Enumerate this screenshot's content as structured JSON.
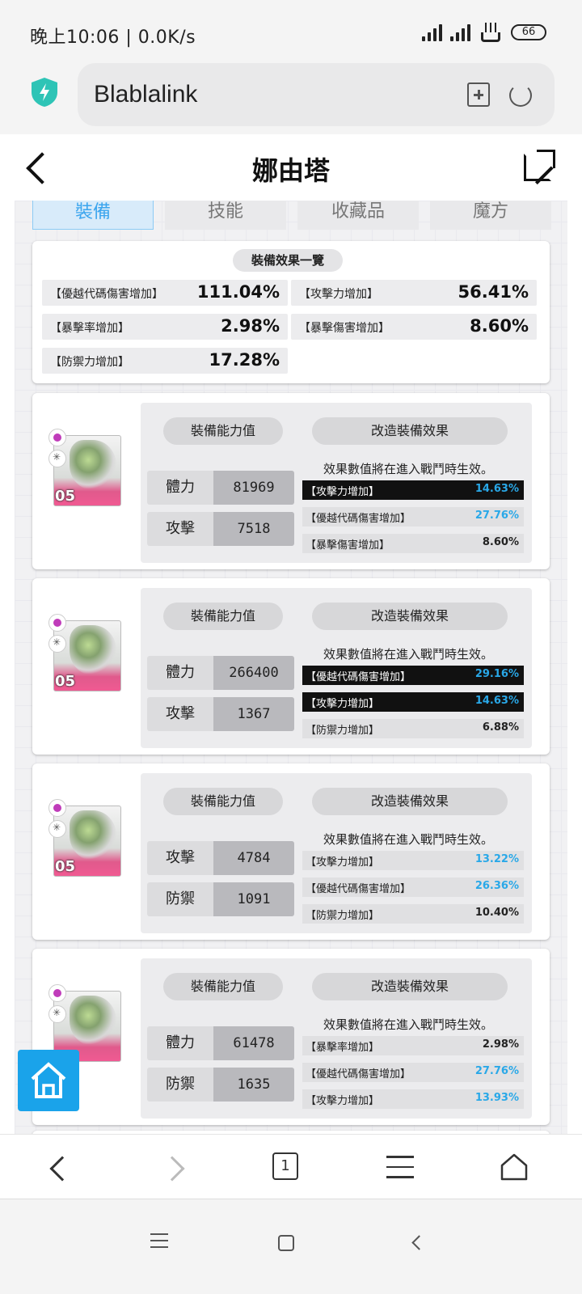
{
  "status_bar": {
    "time": "晚上10:06 | 0.0K/s",
    "battery": "66"
  },
  "browser": {
    "url": "Blablalink"
  },
  "header": {
    "title": "娜由塔"
  },
  "tabs": [
    {
      "label": "裝備",
      "active": true
    },
    {
      "label": "技能",
      "active": false
    },
    {
      "label": "收藏品",
      "active": false
    },
    {
      "label": "魔方",
      "active": false
    }
  ],
  "summary": {
    "title": "裝備效果一覽",
    "items": [
      {
        "label": "【優越代碼傷害增加】",
        "value": "111.04%"
      },
      {
        "label": "【攻擊力增加】",
        "value": "56.41%"
      },
      {
        "label": "【暴擊率增加】",
        "value": "2.98%"
      },
      {
        "label": "【暴擊傷害增加】",
        "value": "8.60%"
      },
      {
        "label": "【防禦力增加】",
        "value": "17.28%"
      }
    ]
  },
  "equipment_common": {
    "stats_title": "裝備能力值",
    "effects_title": "改造裝備效果",
    "note": "效果數值將在進入戰鬥時生效。"
  },
  "equipment": [
    {
      "level": "05",
      "stats": [
        {
          "label": "體力",
          "value": "81969"
        },
        {
          "label": "攻擊",
          "value": "7518"
        }
      ],
      "effects": [
        {
          "label": "【攻擊力增加】",
          "value": "14.63%",
          "highlight": true,
          "value_color": "blue"
        },
        {
          "label": "【優越代碼傷害增加】",
          "value": "27.76%",
          "highlight": false,
          "value_color": "blue"
        },
        {
          "label": "【暴擊傷害增加】",
          "value": "8.60%",
          "highlight": false,
          "value_color": "black"
        }
      ]
    },
    {
      "level": "05",
      "stats": [
        {
          "label": "體力",
          "value": "266400"
        },
        {
          "label": "攻擊",
          "value": "1367"
        }
      ],
      "effects": [
        {
          "label": "【優越代碼傷害增加】",
          "value": "29.16%",
          "highlight": true,
          "value_color": "blue"
        },
        {
          "label": "【攻擊力增加】",
          "value": "14.63%",
          "highlight": true,
          "value_color": "blue"
        },
        {
          "label": "【防禦力增加】",
          "value": "6.88%",
          "highlight": false,
          "value_color": "black"
        }
      ]
    },
    {
      "level": "05",
      "stats": [
        {
          "label": "攻擊",
          "value": "4784"
        },
        {
          "label": "防禦",
          "value": "1091"
        }
      ],
      "effects": [
        {
          "label": "【攻擊力增加】",
          "value": "13.22%",
          "highlight": false,
          "value_color": "blue"
        },
        {
          "label": "【優越代碼傷害增加】",
          "value": "26.36%",
          "highlight": false,
          "value_color": "blue"
        },
        {
          "label": "【防禦力增加】",
          "value": "10.40%",
          "highlight": false,
          "value_color": "black"
        }
      ]
    },
    {
      "level": "",
      "stats": [
        {
          "label": "體力",
          "value": "61478"
        },
        {
          "label": "防禦",
          "value": "1635"
        }
      ],
      "effects": [
        {
          "label": "【暴擊率增加】",
          "value": "2.98%",
          "highlight": false,
          "value_color": "black"
        },
        {
          "label": "【優越代碼傷害增加】",
          "value": "27.76%",
          "highlight": false,
          "value_color": "blue"
        },
        {
          "label": "【攻擊力增加】",
          "value": "13.93%",
          "highlight": false,
          "value_color": "blue"
        }
      ]
    }
  ],
  "browser_nav": {
    "tab_count": "1"
  },
  "colors": {
    "accent": "#1aa3ea",
    "value_blue": "#29a8e8",
    "pink": "#f05a92"
  },
  "icons": [
    "shield-icon",
    "bookmark-add-icon",
    "reload-icon",
    "back-icon",
    "external-link-icon",
    "home-icon",
    "forward-icon",
    "tabs-icon",
    "menu-icon"
  ]
}
